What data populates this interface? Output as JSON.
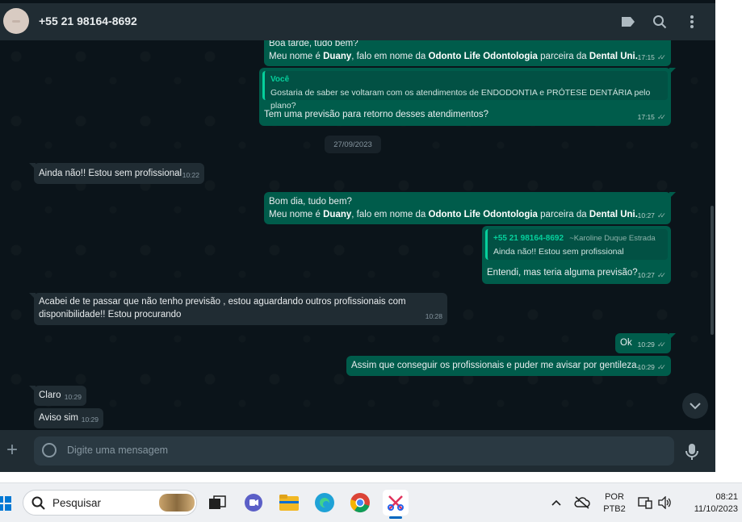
{
  "header": {
    "contact": "+55 21 98164-8692"
  },
  "chat": {
    "msg1": {
      "line1": "Boa tarde, tudo bem?",
      "line2_a": "Meu nome é ",
      "name": "Duany",
      "line2_b": ", falo em nome da ",
      "company": "Odonto Life Odontologia",
      "line2_c": " parceira da ",
      "partner": "Dental Uni.",
      "time": "17:15"
    },
    "msg2": {
      "quote_author": "Você",
      "quote_text": "Gostaria de saber se voltaram com os atendimentos de ENDODONTIA e PRÓTESE DENTÁRIA pelo plano?",
      "text": "Tem uma previsão para retorno desses atendimentos?",
      "time": "17:15"
    },
    "date_chip": "27/09/2023",
    "msg3": {
      "text": "Ainda não!! Estou sem profissional",
      "time": "10:22"
    },
    "msg4": {
      "line1": "Bom dia, tudo bem?",
      "line2_a": "Meu nome é ",
      "name": "Duany",
      "line2_b": ", falo em nome da ",
      "company": "Odonto Life Odontologia",
      "line2_c": " parceira da ",
      "partner": "Dental Uni.",
      "time": "10:27"
    },
    "msg5": {
      "quote_author": "+55 21 98164-8692",
      "quote_alias": "~Karoline Duque Estrada",
      "quote_text": "Ainda não!! Estou sem profissional",
      "text": "Entendi, mas teria alguma previsão?",
      "time": "10:27"
    },
    "msg6": {
      "line1": "Acabei de te passar que não tenho previsão , estou aguardando outros profissionais com",
      "line2": "disponibilidade!! Estou procurando",
      "time": "10:28"
    },
    "msg7": {
      "text": "Ok",
      "time": "10:29"
    },
    "msg8": {
      "text": "Assim que conseguir os profissionais e puder me avisar por gentileza.",
      "time": "10:29"
    },
    "msg9": {
      "text": "Claro",
      "time": "10:29"
    },
    "msg10": {
      "text": "Aviso sim",
      "time": "10:29"
    }
  },
  "composer": {
    "placeholder": "Digite uma mensagem"
  },
  "taskbar": {
    "search_label": "Pesquisar",
    "lang_line1": "POR",
    "lang_line2": "PTB2",
    "time": "08:21",
    "date": "11/10/2023"
  },
  "colors": {
    "outgoing": "#005c4b",
    "incoming": "#202c33",
    "background": "#0b141a",
    "accent": "#06cf9c"
  }
}
